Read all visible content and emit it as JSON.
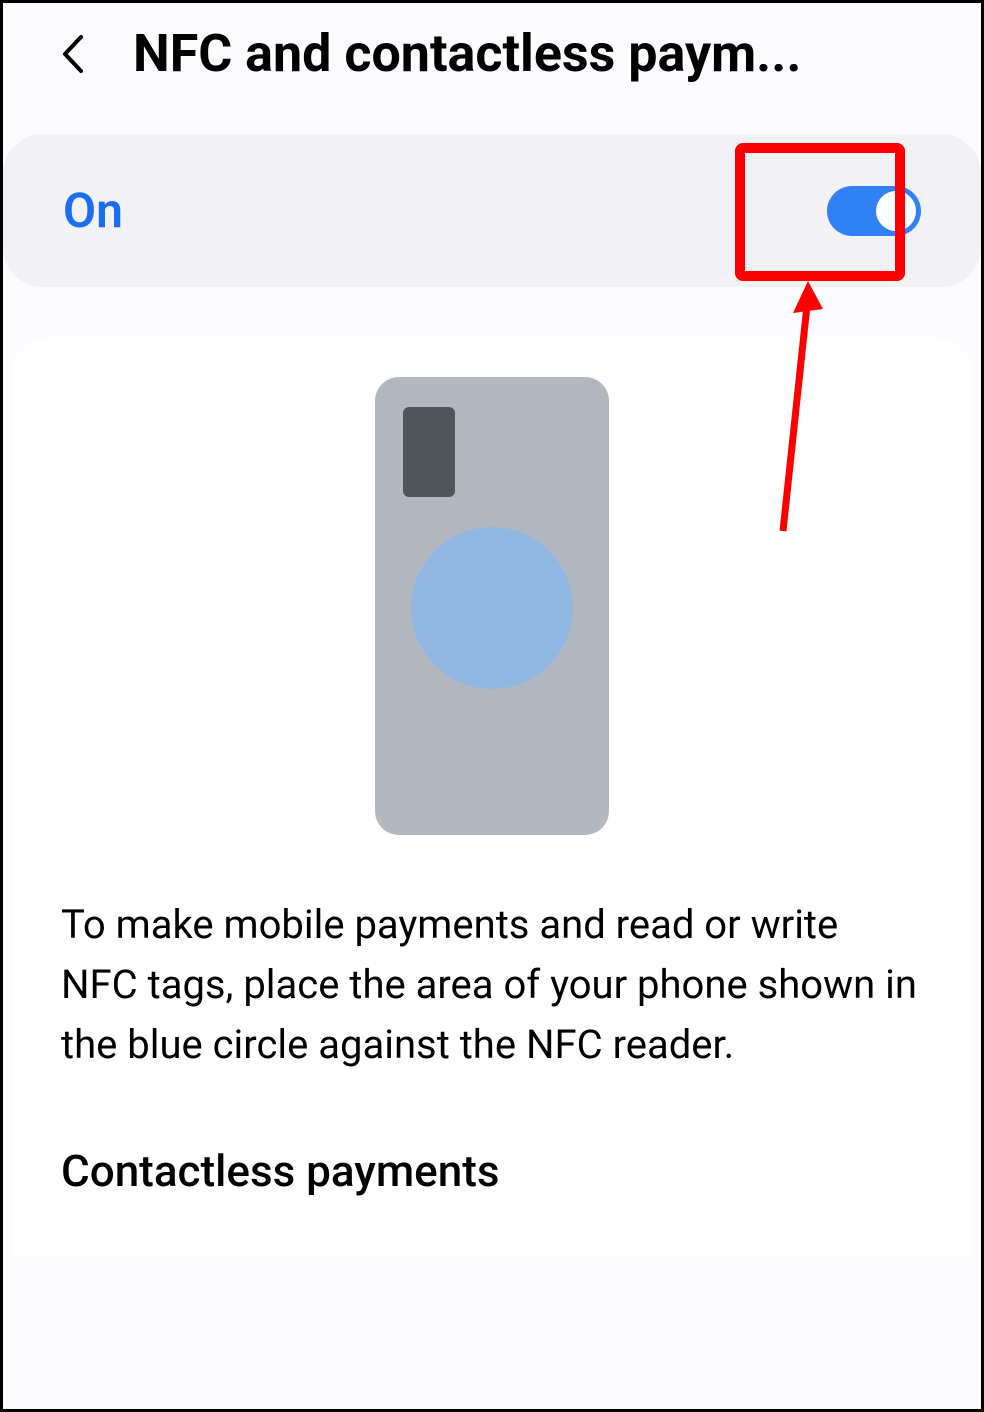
{
  "header": {
    "title": "NFC and contactless paym..."
  },
  "toggle": {
    "label": "On",
    "enabled": true
  },
  "info": {
    "description": "To make mobile payments and read or write NFC tags, place the area of your phone shown in the blue circle against the NFC reader."
  },
  "section": {
    "title": "Contactless payments"
  },
  "annotation": {
    "highlight_color": "#ff0000"
  }
}
